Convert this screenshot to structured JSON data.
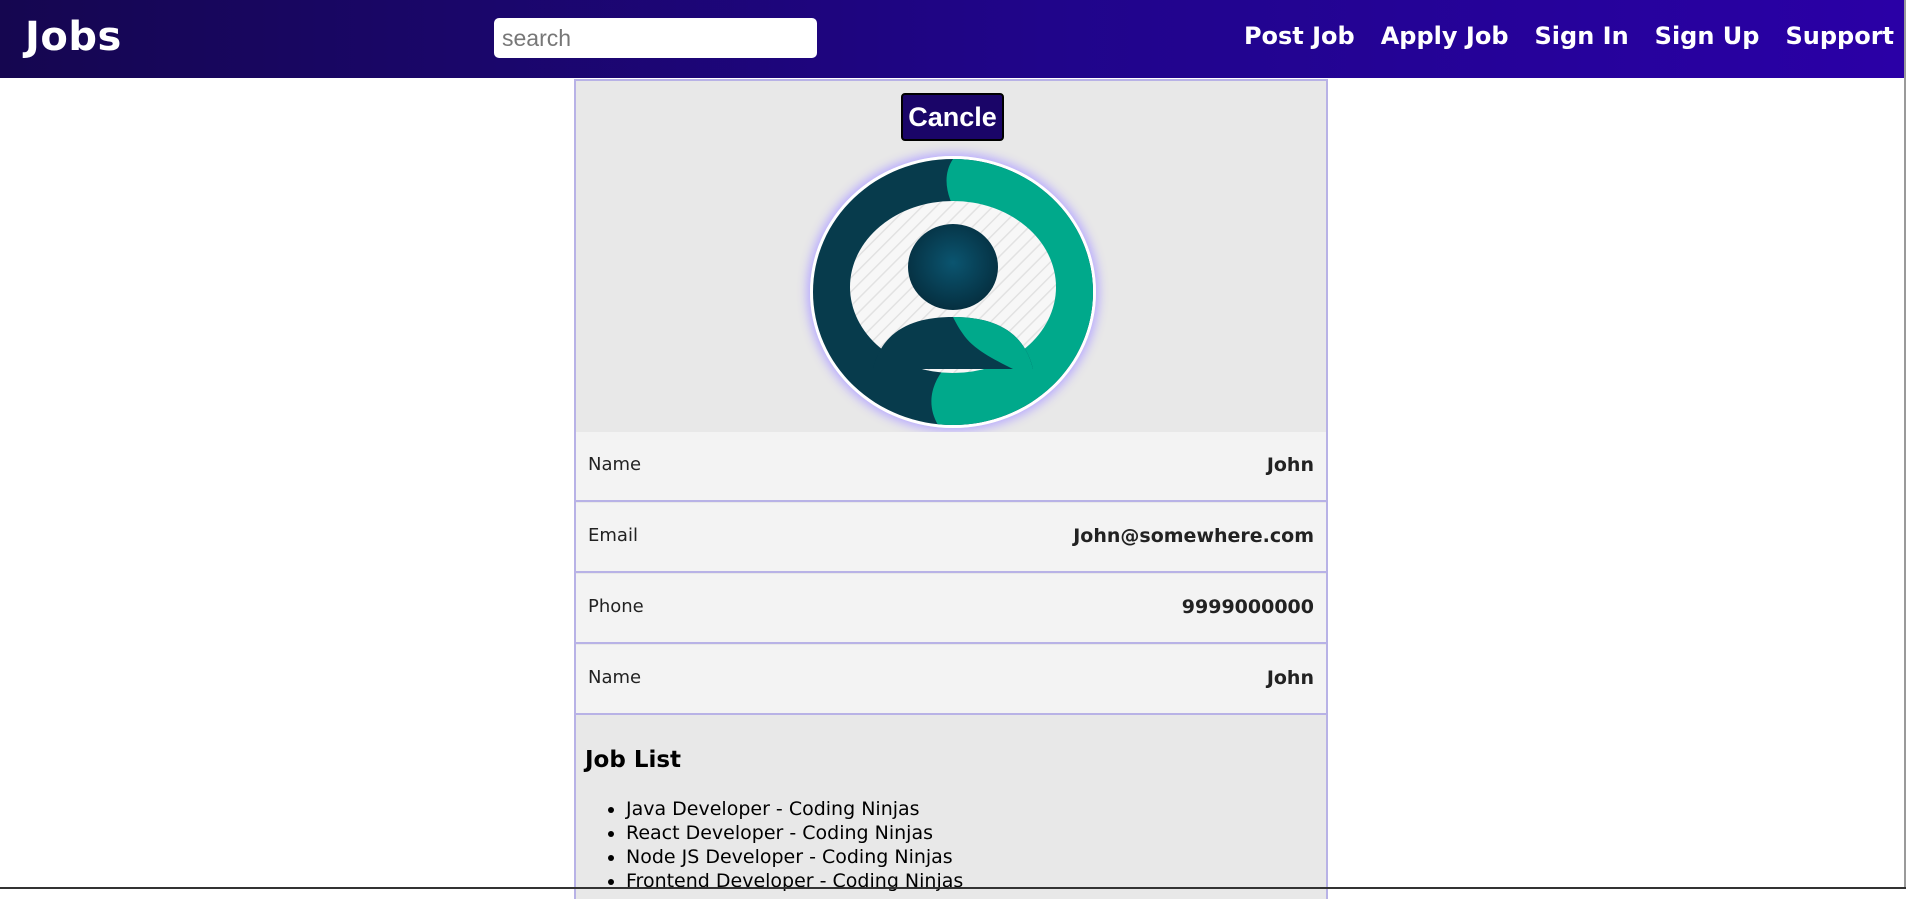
{
  "navbar": {
    "brand": "Jobs",
    "search_placeholder": "search",
    "links": [
      "Post Job",
      "Apply Job",
      "Sign In",
      "Sign Up",
      "Support"
    ]
  },
  "profile": {
    "cancel_label": "Cancle",
    "avatar_icon": "user-avatar-icon",
    "rows": [
      {
        "label": "Name",
        "value": "John"
      },
      {
        "label": "Email",
        "value": "John@somewhere.com"
      },
      {
        "label": "Phone",
        "value": "9999000000"
      },
      {
        "label": "Name",
        "value": "John"
      }
    ]
  },
  "job_list": {
    "title": "Job List",
    "items": [
      "Java Developer - Coding Ninjas",
      "React Developer - Coding Ninjas",
      "Node JS Developer - Coding Ninjas",
      "Frontend Developer - Coding Ninjas"
    ]
  },
  "colors": {
    "navbar_start": "#150650",
    "navbar_end": "#2a00a6",
    "card_border": "#b8b2e6",
    "avatar_dark": "#073b4c",
    "avatar_teal": "#00a98b"
  }
}
